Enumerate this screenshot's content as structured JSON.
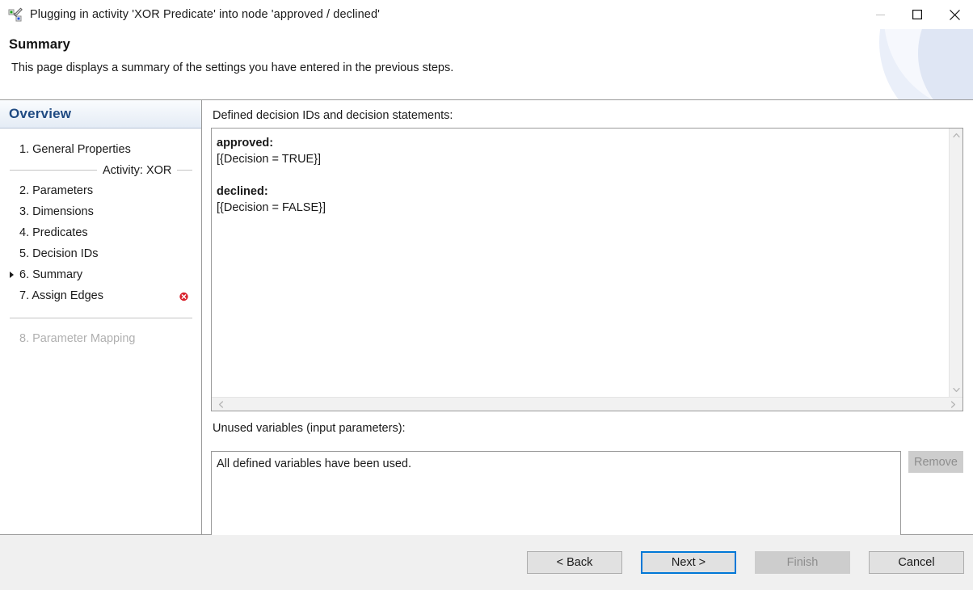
{
  "window": {
    "title": "Plugging in activity 'XOR Predicate' into node 'approved / declined'",
    "icon": "activity-node-edit-icon",
    "controls": {
      "minimize": "minimize-icon",
      "maximize": "maximize-icon",
      "close": "close-icon"
    }
  },
  "banner": {
    "title": "Summary",
    "description": "This page displays a summary of the settings you have entered in the previous steps."
  },
  "sidebar": {
    "header": "Overview",
    "items": [
      {
        "label": "1. General Properties",
        "state": "normal",
        "current": false,
        "error": false
      },
      {
        "label": "2. Parameters",
        "state": "normal",
        "current": false,
        "error": false
      },
      {
        "label": "3. Dimensions",
        "state": "normal",
        "current": false,
        "error": false
      },
      {
        "label": "4. Predicates",
        "state": "normal",
        "current": false,
        "error": false
      },
      {
        "label": "5. Decision IDs",
        "state": "normal",
        "current": false,
        "error": false
      },
      {
        "label": "6. Summary",
        "state": "normal",
        "current": true,
        "error": false
      },
      {
        "label": "7. Assign Edges",
        "state": "normal",
        "current": false,
        "error": true
      },
      {
        "label": "8. Parameter Mapping",
        "state": "disabled",
        "current": false,
        "error": false
      }
    ],
    "group_separator": "Activity: XOR",
    "error_icon": "error-circle-icon"
  },
  "main": {
    "decisions_label": "Defined decision IDs and decision statements:",
    "decisions_lines": [
      {
        "text": "approved:",
        "bold": true
      },
      {
        "text": "[{Decision = TRUE}]",
        "bold": false
      },
      {
        "text": "",
        "bold": false
      },
      {
        "text": "declined:",
        "bold": true
      },
      {
        "text": "[{Decision = FALSE}]",
        "bold": false
      }
    ],
    "unused_label": "Unused variables (input parameters):",
    "unused_text": "All defined variables have been used.",
    "remove_label": "Remove",
    "scrollbar": {
      "up": "chevron-up-icon",
      "down": "chevron-down-icon",
      "left": "chevron-left-icon",
      "right": "chevron-right-icon"
    }
  },
  "footer": {
    "back": "< Back",
    "next": "Next >",
    "finish": "Finish",
    "cancel": "Cancel"
  },
  "colors": {
    "accent": "#0078d7",
    "sidebar_header_text": "#1f4a82",
    "error": "#d9232d",
    "disabled_text": "#8e8e8e"
  }
}
